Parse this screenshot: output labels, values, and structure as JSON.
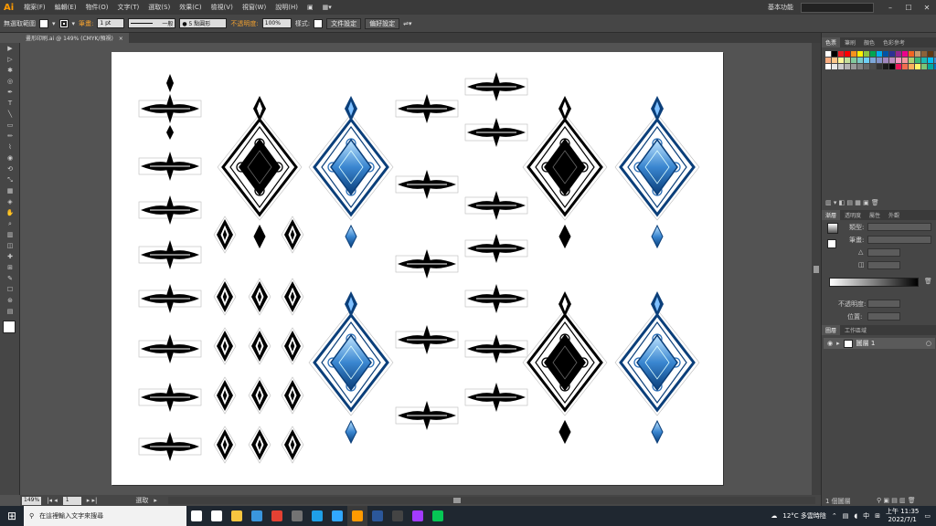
{
  "app": {
    "logo": "Ai"
  },
  "menu": [
    "檔案(F)",
    "編輯(E)",
    "物件(O)",
    "文字(T)",
    "選取(S)",
    "效果(C)",
    "檢視(V)",
    "視窗(W)",
    "說明(H)"
  ],
  "workspace": "基本功能",
  "window_controls": {
    "minimize": "–",
    "maximize": "☐",
    "close": "✕"
  },
  "control_bar": {
    "selection": "無選取範圍",
    "stroke_label": "筆畫:",
    "stroke_value": "1 pt",
    "line_style": "一般",
    "brush": "● 5 點圓形",
    "opacity_label": "不透明度:",
    "opacity_value": "100%",
    "style_label": "樣式:",
    "doc_setup": "文件設定",
    "prefs": "偏好設定"
  },
  "doc_tab": {
    "title": "畫形印刷.ai @ 149% (CMYK/預視)",
    "close": "×"
  },
  "tools": [
    "▶",
    "▷",
    "✱",
    "◎",
    "✒",
    "T",
    "╲",
    "▭",
    "✏",
    "⌇",
    "◉",
    "⟲",
    "⤡",
    "▦",
    "◈",
    "✋",
    "⌕",
    "▥",
    "◫",
    "✚",
    "⊞",
    "✎",
    "☐",
    "⊛",
    "▤"
  ],
  "status": {
    "zoom": "149%",
    "page": "1",
    "text": "選取"
  },
  "swatches_panel": {
    "tabs": [
      "色票",
      "筆刷",
      "顏色",
      "色彩參考"
    ],
    "colors": [
      "#ffffff",
      "#000000",
      "#ed1c24",
      "#ff0000",
      "#f7931e",
      "#fff200",
      "#8dc63f",
      "#00a651",
      "#00aeef",
      "#0054a6",
      "#2e3192",
      "#92278f",
      "#ec008c",
      "#f26522",
      "#c69c6d",
      "#8c6239",
      "#603913",
      "#736357",
      "#998675",
      "#c7b299",
      "#f9ad81",
      "#fdc68a",
      "#fff799",
      "#c4df9b",
      "#82ca9c",
      "#7accc8",
      "#6dcff6",
      "#7da7d9",
      "#8493ca",
      "#a187be",
      "#bc8dbf",
      "#f49ac1",
      "#f5989d",
      "#acd373",
      "#3cb878",
      "#1cbbb4",
      "#00bff3",
      "#448ccb",
      "#5674b9",
      "#605ca8",
      "#ffffff",
      "#e6e6e6",
      "#cccccc",
      "#b3b3b3",
      "#999999",
      "#808080",
      "#666666",
      "#4d4d4d",
      "#333333",
      "#1a1a1a",
      "#000000",
      "#ed145b",
      "#f26c4f",
      "#fbaf5d",
      "#fff568",
      "#7cc576",
      "#00a99d",
      "#0072bc",
      "#662d91",
      "#9e005d"
    ]
  },
  "gradient_panel": {
    "tabs": [
      "漸層",
      "透明度",
      "屬性",
      "外觀",
      "圖層"
    ],
    "type_label": "類型:",
    "stroke_label": "筆畫:",
    "opacity_label": "不透明度:",
    "position_label": "位置:"
  },
  "layers_panel": {
    "tabs": [
      "圖層",
      "工作區域"
    ],
    "layer_name": "圖層 1",
    "count": "1 個圖層"
  },
  "taskbar": {
    "start": "⊞",
    "search_placeholder": "在這裡輸入文字來搜尋",
    "apps": [
      {
        "name": "cortana",
        "color": "#ffffff"
      },
      {
        "name": "task-view",
        "color": "#ffffff"
      },
      {
        "name": "file-explorer",
        "color": "#f8c640"
      },
      {
        "name": "store",
        "color": "#3a96dd"
      },
      {
        "name": "chrome",
        "color": "#e34133"
      },
      {
        "name": "calculator",
        "color": "#737373"
      },
      {
        "name": "edge",
        "color": "#1fa0e8"
      },
      {
        "name": "photoshop",
        "color": "#31a8ff"
      },
      {
        "name": "illustrator",
        "color": "#ff9a00"
      },
      {
        "name": "word",
        "color": "#2b579a"
      },
      {
        "name": "app-5",
        "color": "#444444"
      },
      {
        "name": "messenger",
        "color": "#a33bff"
      },
      {
        "name": "line",
        "color": "#06c755"
      }
    ],
    "weather": "12°C 多雲時陰",
    "ime": "中",
    "time": "上午 11:35",
    "date": "2022/7/1"
  }
}
